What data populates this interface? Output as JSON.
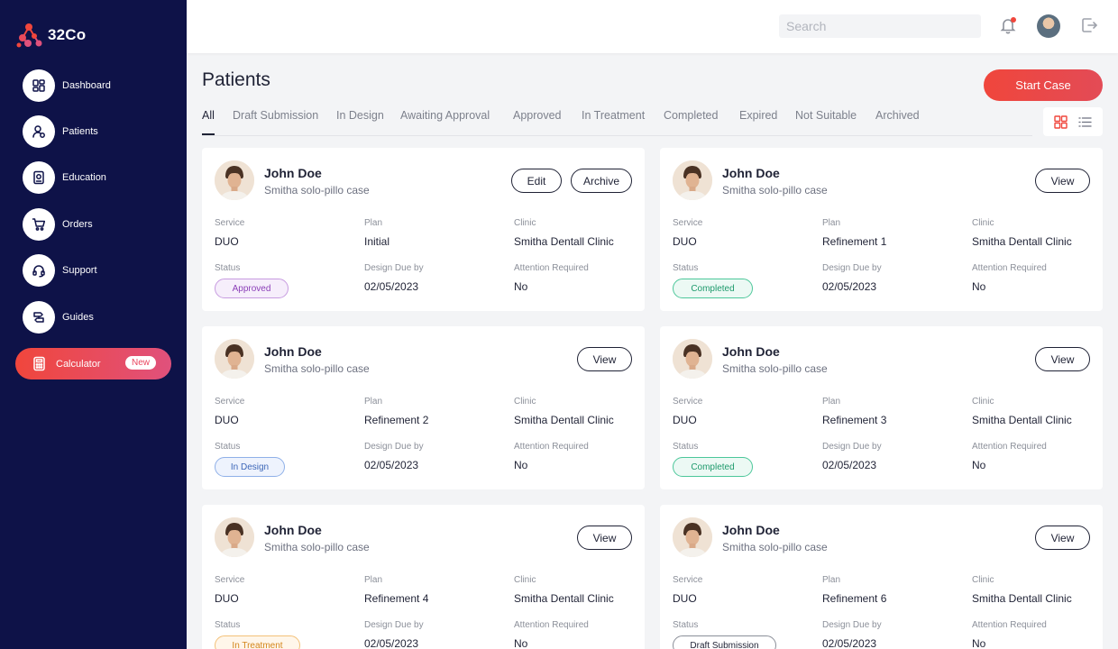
{
  "brand": {
    "name": "32Co"
  },
  "sidebar": {
    "items": [
      {
        "label": "Dashboard",
        "icon": "dashboard-icon"
      },
      {
        "label": "Patients",
        "icon": "patients-icon"
      },
      {
        "label": "Education",
        "icon": "education-icon"
      },
      {
        "label": "Orders",
        "icon": "cart-icon"
      },
      {
        "label": "Support",
        "icon": "headset-icon"
      },
      {
        "label": "Guides",
        "icon": "guides-icon"
      }
    ],
    "calculator": {
      "label": "Calculator",
      "badge": "New"
    }
  },
  "header": {
    "search_placeholder": "Search"
  },
  "main": {
    "title": "Patients",
    "start_case_label": "Start Case",
    "tabs": [
      "All",
      "Draft Submission",
      "In Design",
      "Awaiting Approval",
      "Approved",
      "In Treatment",
      "Completed",
      "Expired",
      "Not Suitable",
      "Archived"
    ],
    "active_tab": "All"
  },
  "field_labels": {
    "service": "Service",
    "plan": "Plan",
    "clinic": "Clinic",
    "status": "Status",
    "design_due": "Design Due by",
    "attention": "Attention Required"
  },
  "cards": [
    {
      "name": "John Doe",
      "case": "Smitha solo-pillo case",
      "service": "DUO",
      "plan": "Initial",
      "clinic": "Smitha Dentall Clinic",
      "status": "Approved",
      "due": "02/05/2023",
      "attention": "No",
      "actions": [
        "Edit",
        "Archive"
      ]
    },
    {
      "name": "John Doe",
      "case": "Smitha solo-pillo case",
      "service": "DUO",
      "plan": "Refinement 1",
      "clinic": "Smitha Dentall Clinic",
      "status": "Completed",
      "due": "02/05/2023",
      "attention": "No",
      "actions": [
        "View"
      ]
    },
    {
      "name": "John Doe",
      "case": "Smitha solo-pillo case",
      "service": "DUO",
      "plan": "Refinement 2",
      "clinic": "Smitha Dentall Clinic",
      "status": "In Design",
      "due": "02/05/2023",
      "attention": "No",
      "actions": [
        "View"
      ]
    },
    {
      "name": "John Doe",
      "case": "Smitha solo-pillo case",
      "service": "DUO",
      "plan": "Refinement 3",
      "clinic": "Smitha Dentall Clinic",
      "status": "Completed",
      "due": "02/05/2023",
      "attention": "No",
      "actions": [
        "View"
      ]
    },
    {
      "name": "John Doe",
      "case": "Smitha solo-pillo case",
      "service": "DUO",
      "plan": "Refinement 4",
      "clinic": "Smitha Dentall Clinic",
      "status": "In Treatment",
      "due": "02/05/2023",
      "attention": "No",
      "actions": [
        "View"
      ]
    },
    {
      "name": "John Doe",
      "case": "Smitha solo-pillo case",
      "service": "DUO",
      "plan": "Refinement 6",
      "clinic": "Smitha Dentall Clinic",
      "status": "Draft Submission",
      "due": "02/05/2023",
      "attention": "No",
      "actions": [
        "View"
      ]
    }
  ],
  "status_colors": {
    "Approved": {
      "bg": "#f6eefb",
      "border": "#c79be0",
      "text": "#8b3fb8"
    },
    "Completed": {
      "bg": "#ecf9f4",
      "border": "#4cc79a",
      "text": "#1e9a6c"
    },
    "In Design": {
      "bg": "#eef3fd",
      "border": "#8fb0e8",
      "text": "#3d67b8"
    },
    "In Treatment": {
      "bg": "#fff6ea",
      "border": "#f3c178",
      "text": "#d4861b"
    },
    "Draft Submission": {
      "bg": "#ffffff",
      "border": "#8b8f99",
      "text": "#1f2235"
    }
  },
  "colors": {
    "sidebar_bg": "#0e1248",
    "accent": "#f0463c"
  }
}
